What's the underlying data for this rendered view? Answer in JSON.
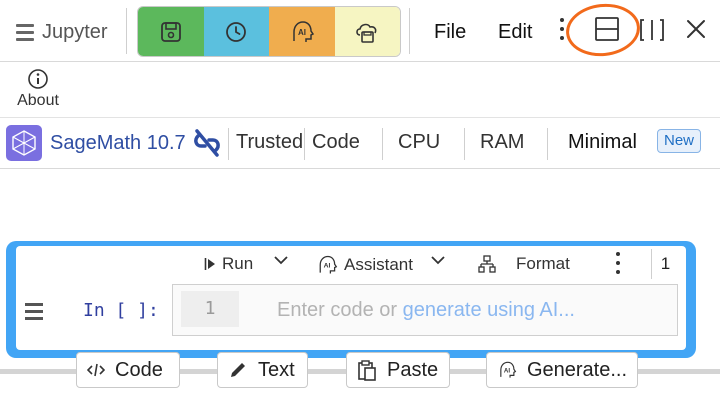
{
  "topbar": {
    "jupyter_label": "Jupyter",
    "color_buttons": [
      {
        "icon": "save-icon",
        "color": "#5cb85c"
      },
      {
        "icon": "clock-icon",
        "color": "#5bc0de"
      },
      {
        "icon": "ai-icon",
        "color": "#f0ad4e"
      },
      {
        "icon": "cloud-save-icon",
        "color": "#f6f5c2"
      }
    ],
    "menus": {
      "file": "File",
      "edit": "Edit"
    },
    "annotation_color": "#f26a1b"
  },
  "about": {
    "label": "About"
  },
  "kernelbar": {
    "kernel_name": "SageMath 10.7",
    "trusted": "Trusted",
    "cell_type": "Code",
    "cpu": "CPU",
    "ram": "RAM",
    "mode": "Minimal",
    "new_badge": "New"
  },
  "cell": {
    "toolbar": {
      "run": "Run",
      "assistant": "Assistant",
      "format": "Format",
      "count": "1"
    },
    "prompt": "In [ ]:",
    "line_number": "1",
    "placeholder_prefix": "Enter code or ",
    "placeholder_link": "generate using AI...",
    "accent_color": "#42a5f5"
  },
  "add_bar": {
    "code": "Code",
    "text": "Text",
    "paste": "Paste",
    "generate": "Generate..."
  }
}
